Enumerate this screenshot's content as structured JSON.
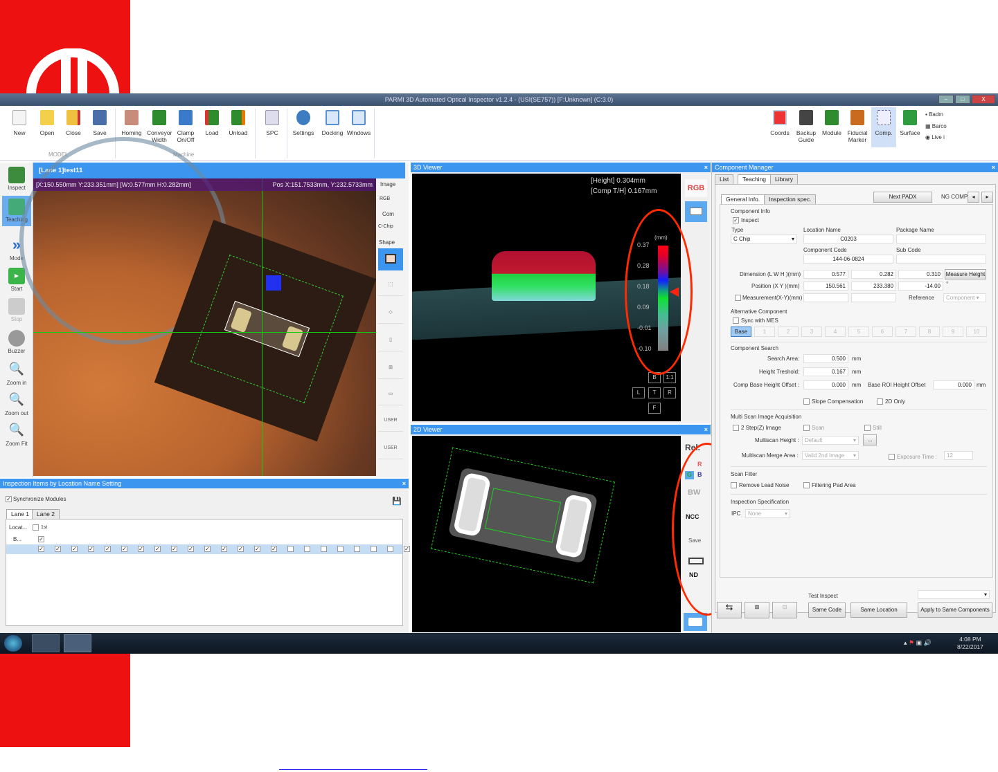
{
  "window": {
    "title": "PARMI 3D Automated Optical Inspector v1.2.4 - (USI(SE757)) [F:Unknown] (C:3.0)",
    "btn_min": "–",
    "btn_max": "□",
    "btn_close": "X"
  },
  "ribbon": {
    "left": [
      {
        "label": "New",
        "icon": "new-file-icon"
      },
      {
        "label": "Open",
        "icon": "folder-open-icon"
      },
      {
        "label": "Close",
        "icon": "folder-close-icon"
      },
      {
        "label": "Save",
        "icon": "save-icon"
      },
      {
        "label": "Homing",
        "icon": "homing-icon"
      },
      {
        "label": "Conveyor Width",
        "icon": "conveyor-icon"
      },
      {
        "label": "Clamp On/Off",
        "icon": "clamp-icon"
      },
      {
        "label": "Load",
        "icon": "load-icon"
      },
      {
        "label": "Unload",
        "icon": "unload-icon"
      },
      {
        "label": "SPC",
        "icon": "spc-icon"
      },
      {
        "label": "Settings",
        "icon": "settings-icon"
      },
      {
        "label": "Docking",
        "icon": "docking-icon"
      },
      {
        "label": "Windows",
        "icon": "windows-icon"
      }
    ],
    "groups": {
      "model": "MODEL",
      "machine": "Machine"
    },
    "right": [
      {
        "label": "Coords",
        "icon": "coords-icon"
      },
      {
        "label": "Backup Guide",
        "icon": "backup-icon"
      },
      {
        "label": "Module",
        "icon": "module-icon"
      },
      {
        "label": "Fiducial Marker",
        "icon": "fiducial-icon"
      },
      {
        "label": "Comp.",
        "icon": "comp-icon"
      },
      {
        "label": "Surface",
        "icon": "surface-icon"
      }
    ],
    "small": [
      "Badm",
      "Barco",
      "Live i"
    ]
  },
  "sidebar": [
    {
      "label": "Inspect"
    },
    {
      "label": "Teaching"
    },
    {
      "label": "Mode"
    },
    {
      "label": "Start"
    },
    {
      "label": "Stop"
    },
    {
      "label": "Buzzer"
    },
    {
      "label": "Zoom in"
    },
    {
      "label": "Zoom out"
    },
    {
      "label": "Zoom Fit"
    }
  ],
  "image_viewer": {
    "title": "[Lane 1]test11",
    "info_left": "[X:150.550mm Y:233.351mm] [W:0.577mm H:0.282mm]",
    "info_right": "Pos X:151.7533mm, Y:232.5733mm",
    "tools": {
      "image": "Image",
      "rgb": "RGB",
      "com": "Com",
      "chip": "C-Chip",
      "shape": "Shape",
      "user1": "USER",
      "user2": "USER"
    }
  },
  "inspection_panel": {
    "title": "Inspection Items by Location Name Setting",
    "sync": "Synchronize Modules",
    "tabs": [
      "Lane 1",
      "Lane 2"
    ],
    "col_loc": "Locat...",
    "col_1st": "1st",
    "row_b": "B..."
  },
  "viewer3d": {
    "title": "3D Viewer",
    "height": "[Height] 0.304mm",
    "comp_th": "[Comp T/H]  0.167mm",
    "unit": "(mm)",
    "scale": [
      "0.37",
      "0.28",
      "0.18",
      "0.09",
      "-0.01",
      "-0.10"
    ],
    "rgb": "RGB",
    "views": [
      "B",
      "1:1",
      "L",
      "T",
      "R",
      "F"
    ]
  },
  "viewer2d": {
    "title": "2D Viewer",
    "tools": [
      "Rel.",
      "R",
      "G",
      "B",
      "BW",
      "NCC",
      "Save",
      "ND"
    ]
  },
  "comp_manager": {
    "title": "Component Manager",
    "tabs": [
      "List",
      "Teaching",
      "Library"
    ],
    "subtabs": [
      "General Info.",
      "Inspection spec."
    ],
    "next": "Next PADX",
    "ng_comp": "NG COMP",
    "prev_arrow": "◂",
    "next_arrow": "▸",
    "component_info": "Component Info",
    "inspect": "Inspect",
    "type_label": "Type",
    "type_value": "C Chip",
    "location_label": "Location Name",
    "location_value": "C0203",
    "package_label": "Package Name",
    "package_value": "",
    "code_label": "Component Code",
    "code_value": "144-06-0824",
    "subcode_label": "Sub Code",
    "subcode_value": "",
    "dimension_label": "Dimension (L W H )(mm)",
    "dim": [
      "0.577",
      "0.282",
      "0.310"
    ],
    "measure_height": "Measure Height",
    "position_label": "Position (X Y )(mm)",
    "pos": [
      "150.561",
      "233.380",
      "-14.00"
    ],
    "deg": "°",
    "measurement_label": "Measurement(X-Y)(mm)",
    "reference_label": "Reference",
    "reference_value": "Component",
    "alt_title": "Alternative Component",
    "sync_mes": "Sync with MES",
    "alt_buttons": [
      "Base",
      "1",
      "2",
      "3",
      "4",
      "5",
      "6",
      "7",
      "8",
      "9",
      "10"
    ],
    "search_title": "Component Search",
    "search_area": "Search Area:",
    "search_area_val": "0.500",
    "height_thr": "Height Treshold:",
    "height_thr_val": "0.167",
    "base_offset": "Comp Base Height Offset :",
    "base_offset_val": "0.000",
    "roi_offset": "Base ROI Height Offset",
    "roi_offset_val": "0.000",
    "mm": "mm",
    "slope": "Slope Compensation",
    "only2d": "2D Only",
    "multi_title": "Multi Scan Image Acquisition",
    "step2": "2 Step(Z) Image",
    "scan": "Scan",
    "still": "Still",
    "ms_height": "Multiscan Height :",
    "ms_height_val": "Default",
    "dots": "...",
    "ms_merge": "Multiscan Merge Area :",
    "ms_merge_val": "Valid 2nd Image",
    "exposure": "Exposure Time :",
    "exposure_val": "12",
    "filter_title": "Scan Filter",
    "remove_lead": "Remove Lead Noise",
    "filter_pad": "Filtering Pad Area",
    "spec_title": "Inspection Specification",
    "ipc": "IPC",
    "ipc_val": "None",
    "test_inspect": "Test Inspect",
    "same_code": "Same Code",
    "same_location": "Same Location",
    "apply_same": "Apply to Same Components"
  },
  "taskbar": {
    "time": "4:08 PM",
    "date": "8/22/2017"
  }
}
